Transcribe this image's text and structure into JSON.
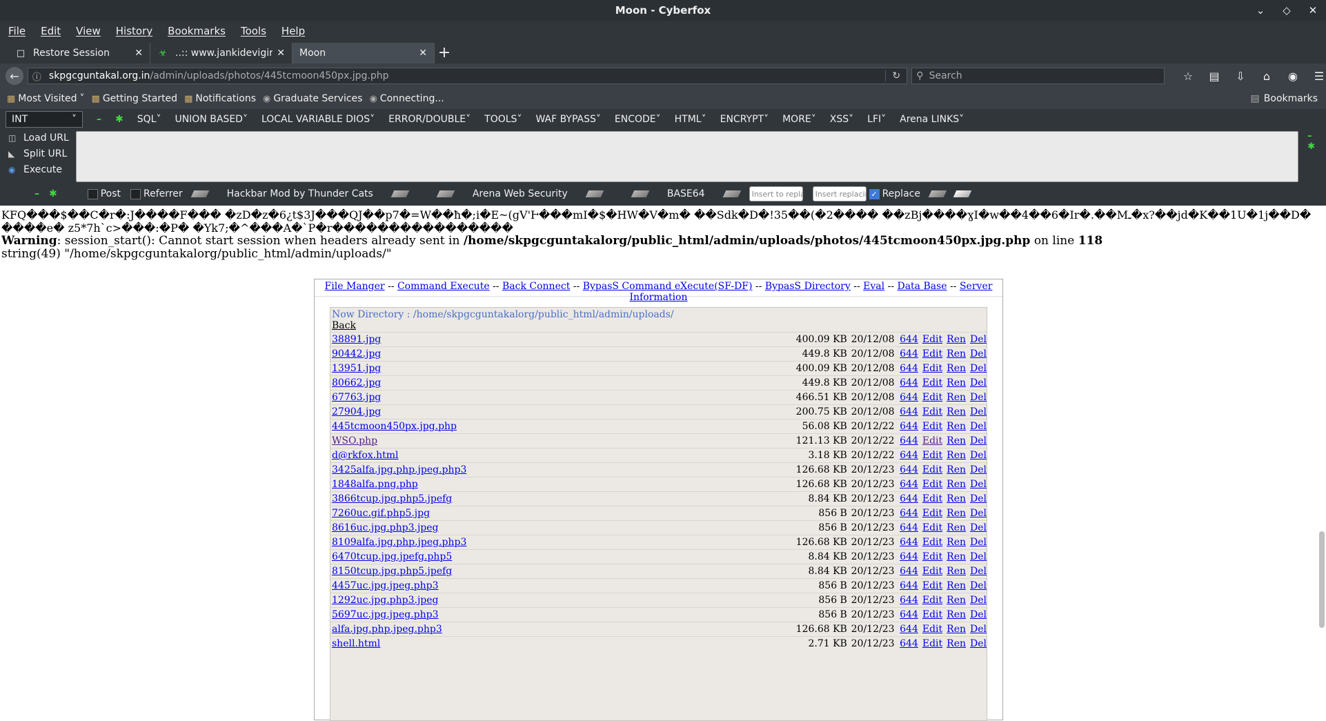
{
  "window": {
    "title": "Moon - Cyberfox"
  },
  "menu": [
    "File",
    "Edit",
    "View",
    "History",
    "Bookmarks",
    "Tools",
    "Help"
  ],
  "tabs": [
    {
      "label": "Restore Session",
      "icon": "restore-icon"
    },
    {
      "label": "..:: www.jankidevigirlsc...",
      "icon": "biohazard-icon"
    },
    {
      "label": "Moon",
      "icon": ""
    }
  ],
  "url": {
    "host": "skpgcguntakal.org.in",
    "path": "/admin/uploads/photos/445tcmoon450px.jpg.php"
  },
  "search": {
    "placeholder": "Search"
  },
  "bookmarks": {
    "items": [
      "Most Visited",
      "Getting Started",
      "Notifications",
      "Graduate Services",
      "Connecting..."
    ],
    "right": "Bookmarks"
  },
  "hackbar": {
    "select_value": "INT",
    "menus": [
      "SQL",
      "UNION BASED",
      "LOCAL VARIABLE DIOS",
      "ERROR/DOUBLE",
      "TOOLS",
      "WAF BYPASS",
      "ENCODE",
      "HTML",
      "ENCRYPT",
      "MORE",
      "XSS",
      "LFI",
      "Arena LINKS"
    ],
    "side": [
      "Load URL",
      "Split URL",
      "Execute"
    ],
    "options": {
      "post": "Post",
      "referrer": "Referrer",
      "mod": "Hackbar Mod by Thunder Cats",
      "arena": "Arena Web Security",
      "base64": "BASE64",
      "insert1": "Insert to replace",
      "insert2": "Insert replacing",
      "replace": "Replace"
    }
  },
  "page": {
    "garbage1": "KFQ���$��C�r�:J����F��� �zD�z�6¿t$3J���QJ��p7�=W��ħ�;i�E~(gV'Ͱ���mI�$�HW�V�m� ��Sdk�D�!35��(�2���� ��zBj����ɣI�w��4��6�Ir�.��Mـ�x?��jd�K��1U�1j��D�",
    "garbage2": "����e� z5*7h`c>���:�P� �Yk7;�^���A�`P�r����������������",
    "warning_label": "Warning",
    "warning_text": ": session_start(): Cannot start session when headers already sent in ",
    "warning_path": "/home/skpgcguntakalorg/public_html/admin/uploads/photos/445tcmoon450px.jpg.php",
    "warning_online": " on line ",
    "warning_line": "118",
    "string_line": "string(49) \"/home/skpgcguntakalorg/public_html/admin/uploads/\""
  },
  "shell": {
    "nav": [
      "File Manger",
      "Command Execute",
      "Back Connect",
      "BypasS Command eXecute(SF-DF)",
      "BypasS Directory",
      "Eval",
      "Data Base",
      "Server Information"
    ],
    "now_dir": "Now Directory : /home/skpgcguntakalorg/public_html/admin/uploads/",
    "back": "Back",
    "actions": {
      "edit": "Edit",
      "ren": "Ren",
      "del": "Del"
    },
    "files": [
      {
        "name": "38891.jpg",
        "size": "400.09 KB",
        "date": "20/12/08",
        "perm": "644"
      },
      {
        "name": "90442.jpg",
        "size": "449.8 KB",
        "date": "20/12/08",
        "perm": "644"
      },
      {
        "name": "13951.jpg",
        "size": "400.09 KB",
        "date": "20/12/08",
        "perm": "644"
      },
      {
        "name": "80662.jpg",
        "size": "449.8 KB",
        "date": "20/12/08",
        "perm": "644"
      },
      {
        "name": "67763.jpg",
        "size": "466.51 KB",
        "date": "20/12/08",
        "perm": "644"
      },
      {
        "name": "27904.jpg",
        "size": "200.75 KB",
        "date": "20/12/08",
        "perm": "644"
      },
      {
        "name": "445tcmoon450px.jpg.php",
        "size": "56.08 KB",
        "date": "20/12/22",
        "perm": "644"
      },
      {
        "name": "WSO.php",
        "size": "121.13 KB",
        "date": "20/12/22",
        "perm": "644"
      },
      {
        "name": "d@rkfox.html",
        "size": "3.18 KB",
        "date": "20/12/22",
        "perm": "644"
      },
      {
        "name": "3425alfa.jpg.php.jpeg.php3",
        "size": "126.68 KB",
        "date": "20/12/23",
        "perm": "644"
      },
      {
        "name": "1848alfa.png.php",
        "size": "126.68 KB",
        "date": "20/12/23",
        "perm": "644"
      },
      {
        "name": "3866tcup.jpg.php5.jpefg",
        "size": "8.84 KB",
        "date": "20/12/23",
        "perm": "644"
      },
      {
        "name": "7260uc.gif.php5.jpg",
        "size": "856 B",
        "date": "20/12/23",
        "perm": "644"
      },
      {
        "name": "8616uc.jpg.php3.jpeg",
        "size": "856 B",
        "date": "20/12/23",
        "perm": "644"
      },
      {
        "name": "8109alfa.jpg.php.jpeg.php3",
        "size": "126.68 KB",
        "date": "20/12/23",
        "perm": "644"
      },
      {
        "name": "6470tcup.jpg.jpefg.php5",
        "size": "8.84 KB",
        "date": "20/12/23",
        "perm": "644"
      },
      {
        "name": "8150tcup.jpg.php5.jpefg",
        "size": "8.84 KB",
        "date": "20/12/23",
        "perm": "644"
      },
      {
        "name": "4457uc.jpg.jpeg.php3",
        "size": "856 B",
        "date": "20/12/23",
        "perm": "644"
      },
      {
        "name": "1292uc.jpg.php3.jpeg",
        "size": "856 B",
        "date": "20/12/23",
        "perm": "644"
      },
      {
        "name": "5697uc.jpg.jpeg.php3",
        "size": "856 B",
        "date": "20/12/23",
        "perm": "644"
      },
      {
        "name": "alfa.jpg.php.jpeg.php3",
        "size": "126.68 KB",
        "date": "20/12/23",
        "perm": "644"
      },
      {
        "name": "shell.html",
        "size": "2.71 KB",
        "date": "20/12/23",
        "perm": "644"
      }
    ]
  }
}
